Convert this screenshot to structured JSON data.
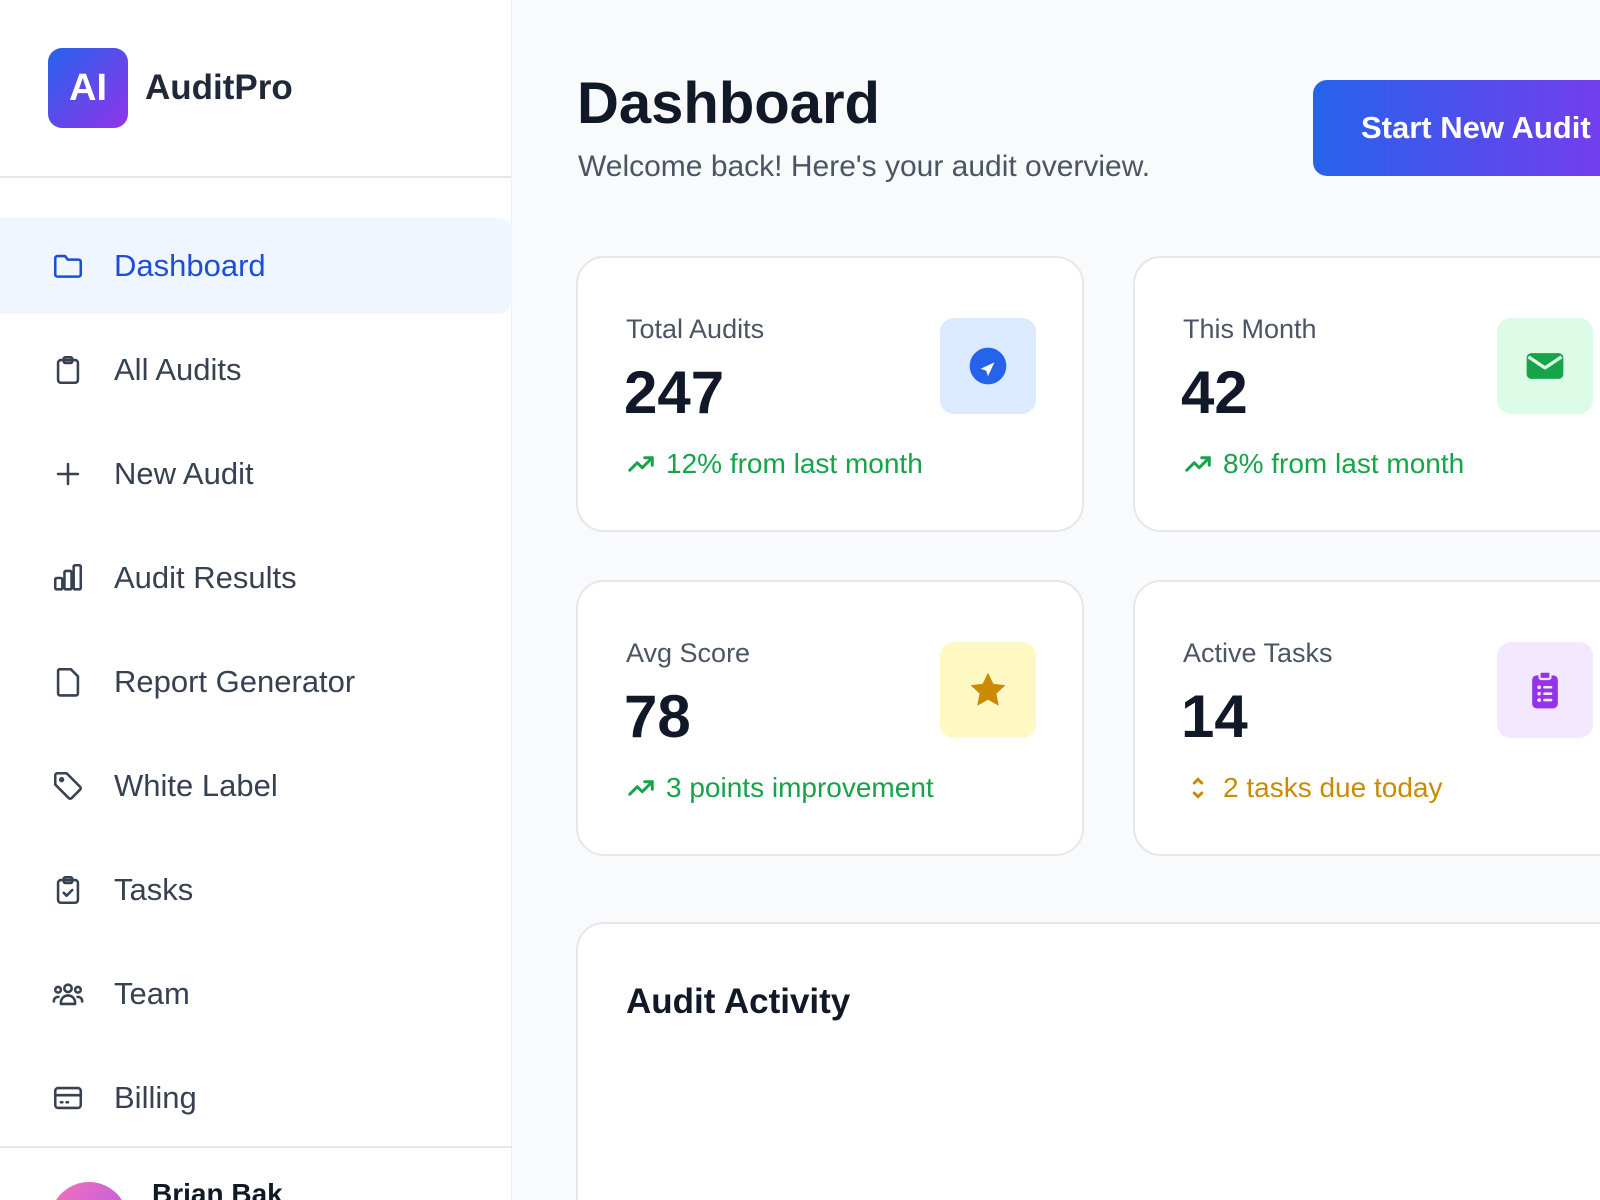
{
  "brand": {
    "logo_text": "AI",
    "name": "AuditPro"
  },
  "sidebar": {
    "items": [
      {
        "label": "Dashboard",
        "icon": "folder-icon",
        "active": true
      },
      {
        "label": "All Audits",
        "icon": "clipboard-icon"
      },
      {
        "label": "New Audit",
        "icon": "plus-icon"
      },
      {
        "label": "Audit Results",
        "icon": "bar-chart-icon"
      },
      {
        "label": "Report Generator",
        "icon": "document-icon"
      },
      {
        "label": "White Label",
        "icon": "tag-icon"
      },
      {
        "label": "Tasks",
        "icon": "clipboard-check-icon"
      },
      {
        "label": "Team",
        "icon": "users-icon"
      },
      {
        "label": "Billing",
        "icon": "credit-card-icon"
      }
    ],
    "user": {
      "name": "Brian Bak"
    }
  },
  "header": {
    "title": "Dashboard",
    "subtitle": "Welcome back! Here's your audit overview.",
    "cta_label": "Start New Audit"
  },
  "stats": [
    {
      "label": "Total Audits",
      "value": "247",
      "trend": "12% from last month",
      "trend_icon": "trending-up-icon",
      "badge_icon": "compass-icon",
      "badge_bg": "#dbeafe",
      "badge_color": "#2563eb"
    },
    {
      "label": "This Month",
      "value": "42",
      "trend": "8% from last month",
      "trend_icon": "trending-up-icon",
      "badge_icon": "mail-icon",
      "badge_bg": "#dcfce7",
      "badge_color": "#16a34a"
    },
    {
      "label": "Avg Score",
      "value": "78",
      "trend": "3 points improvement",
      "trend_icon": "trending-up-icon",
      "badge_icon": "star-icon",
      "badge_bg": "#fef9c3",
      "badge_color": "#ca8a04"
    },
    {
      "label": "Active Tasks",
      "value": "14",
      "trend": "2 tasks due today",
      "trend_icon": "chevron-up-down-icon",
      "badge_icon": "clipboard-list-icon",
      "badge_bg": "#f3e8ff",
      "badge_color": "#9333ea"
    }
  ],
  "activity": {
    "title": "Audit Activity"
  },
  "colors": {
    "accent": "#1d4ed8",
    "positive": "#16a34a",
    "warning": "#ca8a04"
  }
}
